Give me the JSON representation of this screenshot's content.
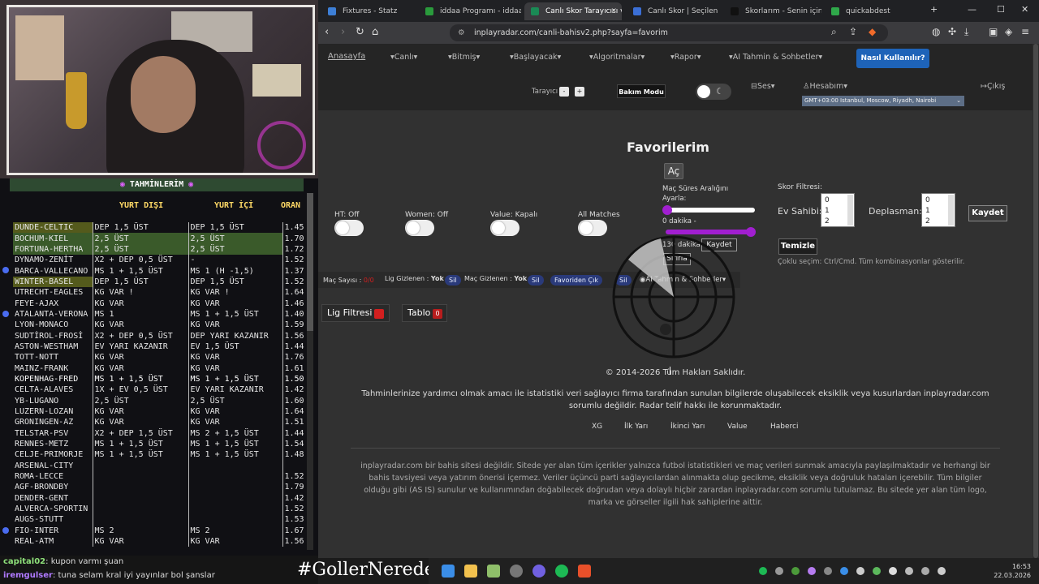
{
  "predictions": {
    "title": "TAHMİNLERİM",
    "header_away": "YURT DIŞI",
    "header_home": "YURT İÇİ",
    "header_odds": "ORAN",
    "rows": [
      {
        "match": "DUNDE-CELTIC",
        "p1": "DEP 1,5 ÜST",
        "p2": "DEP 1,5 ÜST",
        "odds": "1.45",
        "hl": "hl2"
      },
      {
        "match": "BOCHUM-KIEL",
        "p1": "2,5 ÜST",
        "p2": "2,5 ÜST",
        "odds": "1.70",
        "hl": "hl"
      },
      {
        "match": "FORTUNA-HERTHA",
        "p1": "2,5 ÜST",
        "p2": "2,5 ÜST",
        "odds": "1.72",
        "hl": "hl"
      },
      {
        "match": "DYNAMO-ZENİT",
        "p1": "X2 + DEP 0,5 ÜST",
        "p2": "-",
        "odds": "1.52",
        "hl": ""
      },
      {
        "match": "BARCA-VALLECANO",
        "p1": "MS 1 + 1,5 ÜST",
        "p2": "MS 1 (H -1,5)",
        "odds": "1.37",
        "hl": "",
        "bullet": true
      },
      {
        "match": "WINTER-BASEL",
        "p1": "DEP 1,5 ÜST",
        "p2": "DEP 1,5 ÜST",
        "odds": "1.52",
        "hl": "hl2"
      },
      {
        "match": "UTRECHT-EAGLES",
        "p1": "KG VAR !",
        "p2": "KG VAR !",
        "odds": "1.64",
        "hl": ""
      },
      {
        "match": "FEYE-AJAX",
        "p1": "KG VAR",
        "p2": "KG VAR",
        "odds": "1.46",
        "hl": ""
      },
      {
        "match": "ATALANTA-VERONA",
        "p1": "MS 1",
        "p2": "MS 1 + 1,5 ÜST",
        "odds": "1.40",
        "hl": "",
        "bullet": true
      },
      {
        "match": "LYON-MONACO",
        "p1": "KG VAR",
        "p2": "KG VAR",
        "odds": "1.59",
        "hl": ""
      },
      {
        "match": "SUDTİROL-FROSİ",
        "p1": "X2 + DEP 0,5 ÜST",
        "p2": "DEP YARI KAZANIR",
        "odds": "1.56",
        "hl": ""
      },
      {
        "match": "ASTON-WESTHAM",
        "p1": "EV YARI KAZANIR",
        "p2": "EV 1,5 ÜST",
        "odds": "1.44",
        "hl": ""
      },
      {
        "match": "TOTT-NOTT",
        "p1": "KG VAR",
        "p2": "KG VAR",
        "odds": "1.76",
        "hl": ""
      },
      {
        "match": "MAINZ-FRANK",
        "p1": "KG VAR",
        "p2": "KG VAR",
        "odds": "1.61",
        "hl": ""
      },
      {
        "match": "KOPENHAG-FRED",
        "p1": "MS 1 + 1,5 ÜST",
        "p2": "MS 1 + 1,5 ÜST",
        "odds": "1.50",
        "hl": "sel"
      },
      {
        "match": "CELTA-ALAVES",
        "p1": "1X + EV 0,5 ÜST",
        "p2": "EV YARI KAZANIR",
        "odds": "1.42",
        "hl": ""
      },
      {
        "match": "YB-LUGANO",
        "p1": "2,5 ÜST",
        "p2": "2,5 ÜST",
        "odds": "1.60",
        "hl": ""
      },
      {
        "match": "LUZERN-LOZAN",
        "p1": "KG VAR",
        "p2": "KG VAR",
        "odds": "1.64",
        "hl": ""
      },
      {
        "match": "GRONINGEN-AZ",
        "p1": "KG VAR",
        "p2": "KG VAR",
        "odds": "1.51",
        "hl": ""
      },
      {
        "match": "TELSTAR-PSV",
        "p1": "X2 + DEP 1,5 ÜST",
        "p2": "MS 2 + 1,5 ÜST",
        "odds": "1.44",
        "hl": ""
      },
      {
        "match": "RENNES-METZ",
        "p1": "MS 1 + 1,5 ÜST",
        "p2": "MS 1 + 1,5 ÜST",
        "odds": "1.54",
        "hl": ""
      },
      {
        "match": "CELJE-PRIMORJE",
        "p1": "MS 1 + 1,5 ÜST",
        "p2": "MS 1 + 1,5 ÜST",
        "odds": "1.48",
        "hl": ""
      },
      {
        "match": "ARSENAL-CITY",
        "p1": "",
        "p2": "",
        "odds": "",
        "hl": ""
      },
      {
        "match": "ROMA-LECCE",
        "p1": "",
        "p2": "",
        "odds": "1.52",
        "hl": ""
      },
      {
        "match": "AGF-BRONDBY",
        "p1": "",
        "p2": "",
        "odds": "1.79",
        "hl": ""
      },
      {
        "match": "DENDER-GENT",
        "p1": "",
        "p2": "",
        "odds": "1.42",
        "hl": ""
      },
      {
        "match": "ALVERCA-SPORTIN",
        "p1": "",
        "p2": "",
        "odds": "1.52",
        "hl": ""
      },
      {
        "match": "AUGS-STUTT",
        "p1": "",
        "p2": "",
        "odds": "1.53",
        "hl": ""
      },
      {
        "match": "FIO-INTER",
        "p1": "MS 2",
        "p2": "MS 2",
        "odds": "1.67",
        "hl": "",
        "bullet": true
      },
      {
        "match": "REAL-ATM",
        "p1": "KG VAR",
        "p2": "KG VAR",
        "odds": "1.56",
        "hl": ""
      }
    ]
  },
  "chat": {
    "m1_user": "capital02",
    "m1_text": ": kupon varmı şuan",
    "m2_user": "iremgulser",
    "m2_text": ": tuna selam kral iyi yayınlar bol şanslar"
  },
  "hashtag": "#GollerNerede",
  "browser": {
    "tabs": [
      {
        "title": "Fixtures - Statz",
        "color": "#3d7fd6"
      },
      {
        "title": "iddaa Programı - iddaa Bi",
        "color": "#2a9b3c"
      },
      {
        "title": "Canlı Skor Tarayıcısı v",
        "color": "#1a8a55",
        "active": true
      },
      {
        "title": "Canlı Skor | Seçilen maçla",
        "color": "#3b6fd6"
      },
      {
        "title": "Skorlarım - Senin için Kişi",
        "color": "#111111"
      },
      {
        "title": "quickabdest",
        "color": "#2fa84a"
      }
    ],
    "url": "inplayradar.com/canli-bahisv2.php?sayfa=favorim"
  },
  "site": {
    "nav": {
      "home": "Anasayfa",
      "live": "Canlı",
      "finished": "Bitmiş",
      "upcoming": "Başlayacak",
      "algorithms": "Algoritmalar",
      "report": "Rapor",
      "ai": "AI Tahmin & Sohbetler",
      "howto": "Nasıl Kullanılır?",
      "scanner": "Tarayıcı",
      "minus": "-",
      "plus": "+",
      "maintenance": "Bakım Modu",
      "sound": "Ses",
      "account": "Hesabım",
      "logout": "Çıkış",
      "timezone": "GMT+03:00 Istanbul, Moscow, Riyadh, Nairobi"
    },
    "favorites_title": "Favorilerim",
    "open_btn": "Aç",
    "switches": {
      "ht": "HT: Off",
      "women": "Women: Off",
      "value": "Value: Kapalı",
      "all": "All Matches"
    },
    "minute_range": {
      "label1": "Maç Süres Aralığını",
      "label2": "Ayarla:",
      "min_text": "0 dakika -",
      "max_text": "130 dakika",
      "save": "Kaydet",
      "reset": "Sıfırla",
      "min_value": 0,
      "max_value": 130
    },
    "score_filter": {
      "title": "Skor Filtresi:",
      "home": "Ev Sahibi:",
      "away": "Deplasman:",
      "home_opts": [
        "0",
        "1",
        "2"
      ],
      "away_opts": [
        "0",
        "1",
        "2"
      ],
      "save": "Kaydet",
      "clear": "Temizle",
      "hint": "Çoklu seçim: Ctrl/Cmd. Tüm kombinasyonlar gösterilir."
    },
    "controls": {
      "match_count": "Maç Sayısı :",
      "match_count_val": "0/0",
      "league_hidden": "Lig Gizlenen :",
      "league_hidden_val": "Yok",
      "delete1": "Sil",
      "match_hidden": "Maç Gizlenen :",
      "match_hidden_val": "Yok",
      "delete2": "Sil",
      "fav_exit": "Favoriden Çık",
      "delete3": "Sil",
      "ai": "AI Tahmin & Sohbetler"
    },
    "league_filter": "Lig Filtresi",
    "table_btn": "Tablo",
    "table_count": "0",
    "copyright": "© 2014-2026 Tüm Hakları Saklıdır.",
    "disclaimer1": "Tahminlerinize yardımcı olmak amacı ile istatistiki veri sağlayıcı firma tarafından sunulan bilgilerde oluşabilecek eksiklik veya kusurlardan inplayradar.com sorumlu değildir. Radar telif hakkı ile korunmaktadır.",
    "footer_links": [
      "XG",
      "İlk Yarı",
      "İkinci Yarı",
      "Value",
      "Haberci"
    ],
    "disclaimer2": "inplayradar.com bir bahis sitesi değildir. Sitede yer alan tüm içerikler yalnızca futbol istatistikleri ve maç verileri sunmak amacıyla paylaşılmaktadır ve herhangi bir bahis tavsiyesi veya yatırım önerisi içermez. Veriler üçüncü parti sağlayıcılardan alınmakta olup gecikme, eksiklik veya doğruluk hataları içerebilir. Tüm bilgiler olduğu gibi (AS IS) sunulur ve kullanımından doğabilecek doğrudan veya dolaylı hiçbir zarardan inplayradar.com sorumlu tutulamaz. Bu sitede yer alan tüm logo, marka ve görseller ilgili hak sahiplerine aittir."
  },
  "taskbar": {
    "time": "16:53",
    "date": "22.03.2026"
  },
  "colors": {
    "accent": "#1e63b8",
    "slider": "#a11fd0",
    "pill": "#2a3a7a",
    "highlight": "#3a5a2a",
    "red": "#d21f1f"
  }
}
